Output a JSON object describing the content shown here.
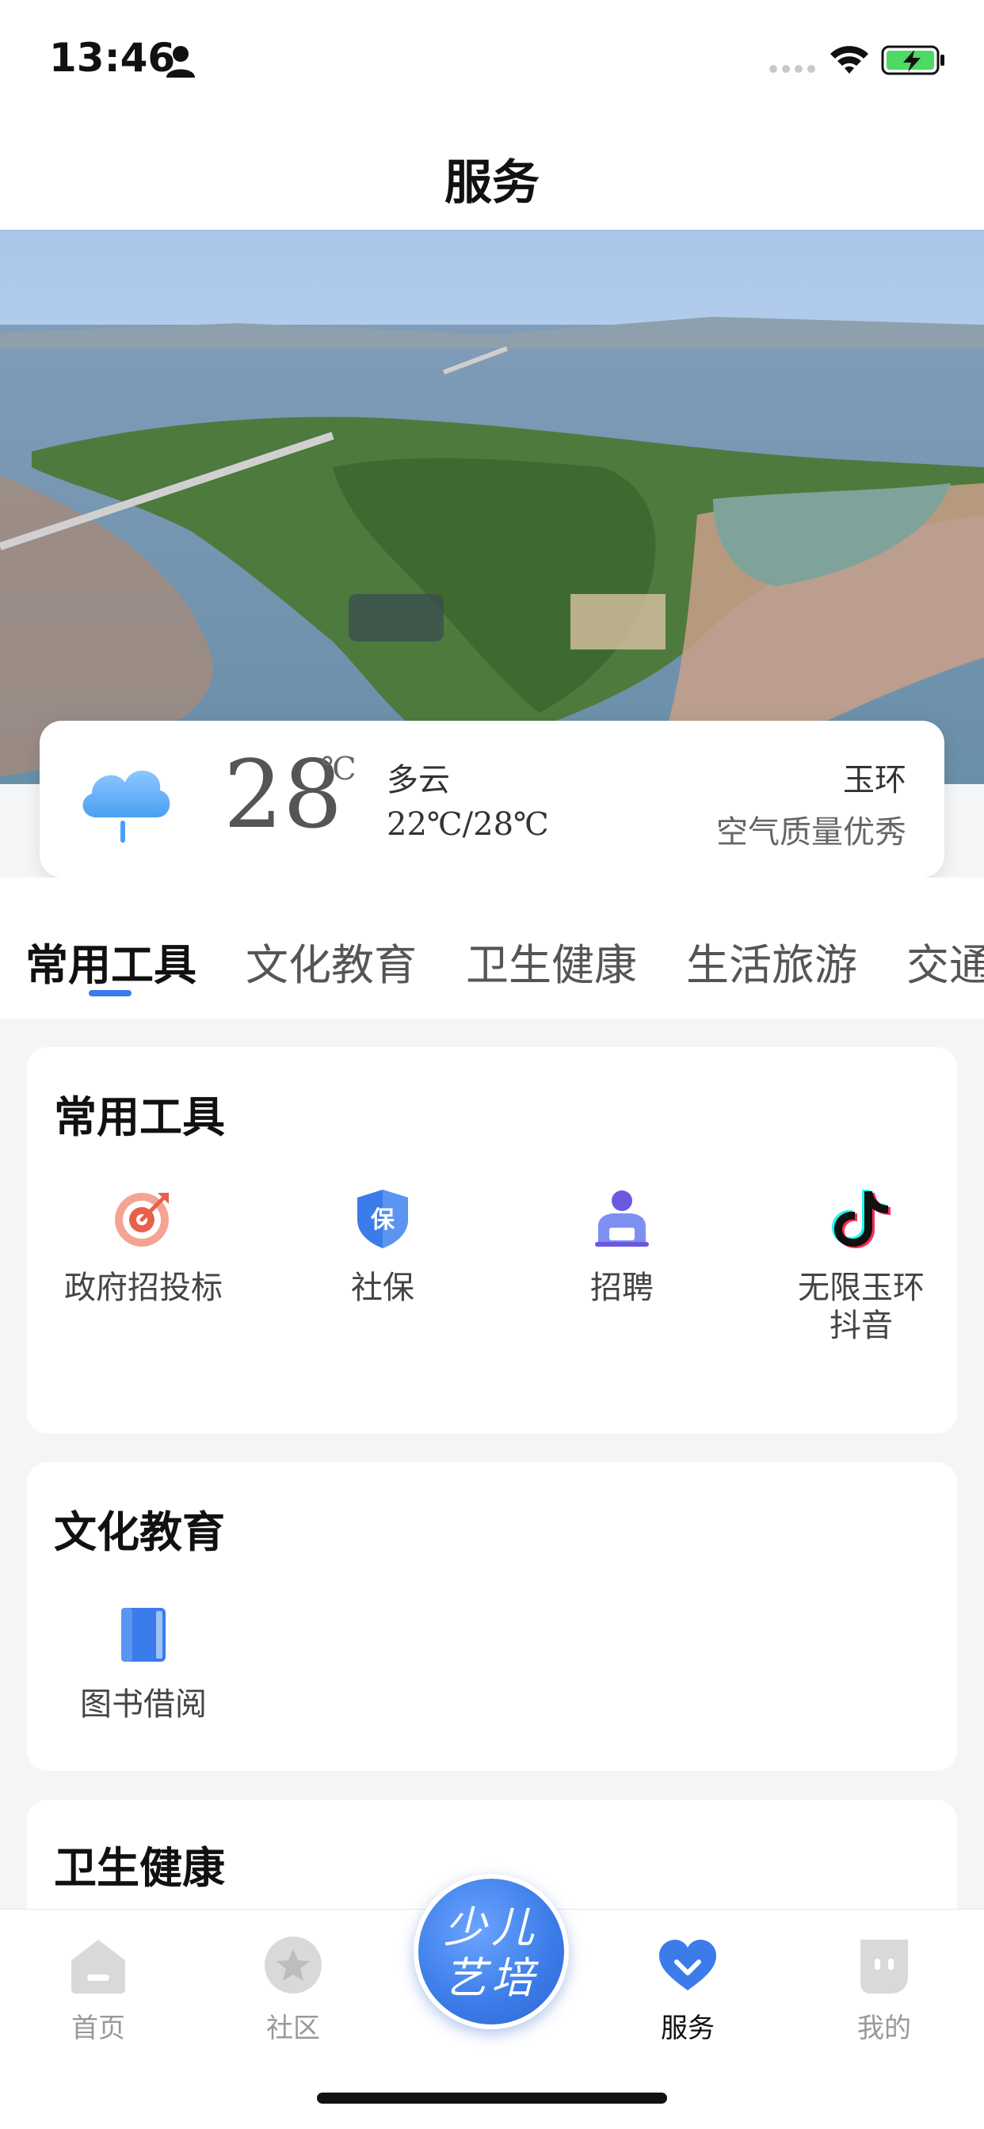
{
  "status_bar": {
    "time": "13:46"
  },
  "header": {
    "title": "服务"
  },
  "weather": {
    "temperature": "28",
    "unit": "℃",
    "condition": "多云",
    "range": "22℃/28℃",
    "city": "玉环",
    "air_quality": "空气质量优秀",
    "icon": "cloud-rain-icon"
  },
  "tabs": [
    {
      "label": "常用工具",
      "active": true
    },
    {
      "label": "文化教育",
      "active": false
    },
    {
      "label": "卫生健康",
      "active": false
    },
    {
      "label": "生活旅游",
      "active": false
    },
    {
      "label": "交通",
      "active": false
    }
  ],
  "sections": [
    {
      "title": "常用工具",
      "items": [
        {
          "label": "政府招投标",
          "icon": "target-icon",
          "color": "#e8604c"
        },
        {
          "label": "社保",
          "icon": "shield-bao-icon",
          "color": "#3b7bea"
        },
        {
          "label": "招聘",
          "icon": "recruit-person-icon",
          "color": "#6a5ae0"
        },
        {
          "label": "无限玉环\n抖音",
          "icon": "tiktok-icon",
          "color": "#111111"
        }
      ]
    },
    {
      "title": "文化教育",
      "items": [
        {
          "label": "图书借阅",
          "icon": "book-icon",
          "color": "#3b7bea"
        }
      ]
    },
    {
      "title": "卫生健康",
      "items": []
    }
  ],
  "tabbar": {
    "items": [
      {
        "label": "首页",
        "icon": "home-icon",
        "active": false
      },
      {
        "label": "社区",
        "icon": "star-icon",
        "active": false
      },
      {
        "label": "服务",
        "icon": "heart-icon",
        "active": true
      },
      {
        "label": "我的",
        "icon": "profile-icon",
        "active": false
      }
    ],
    "center_badge": "少儿艺培"
  },
  "colors": {
    "accent": "#3b7bea",
    "text_primary": "#111111",
    "text_secondary": "#999999"
  }
}
